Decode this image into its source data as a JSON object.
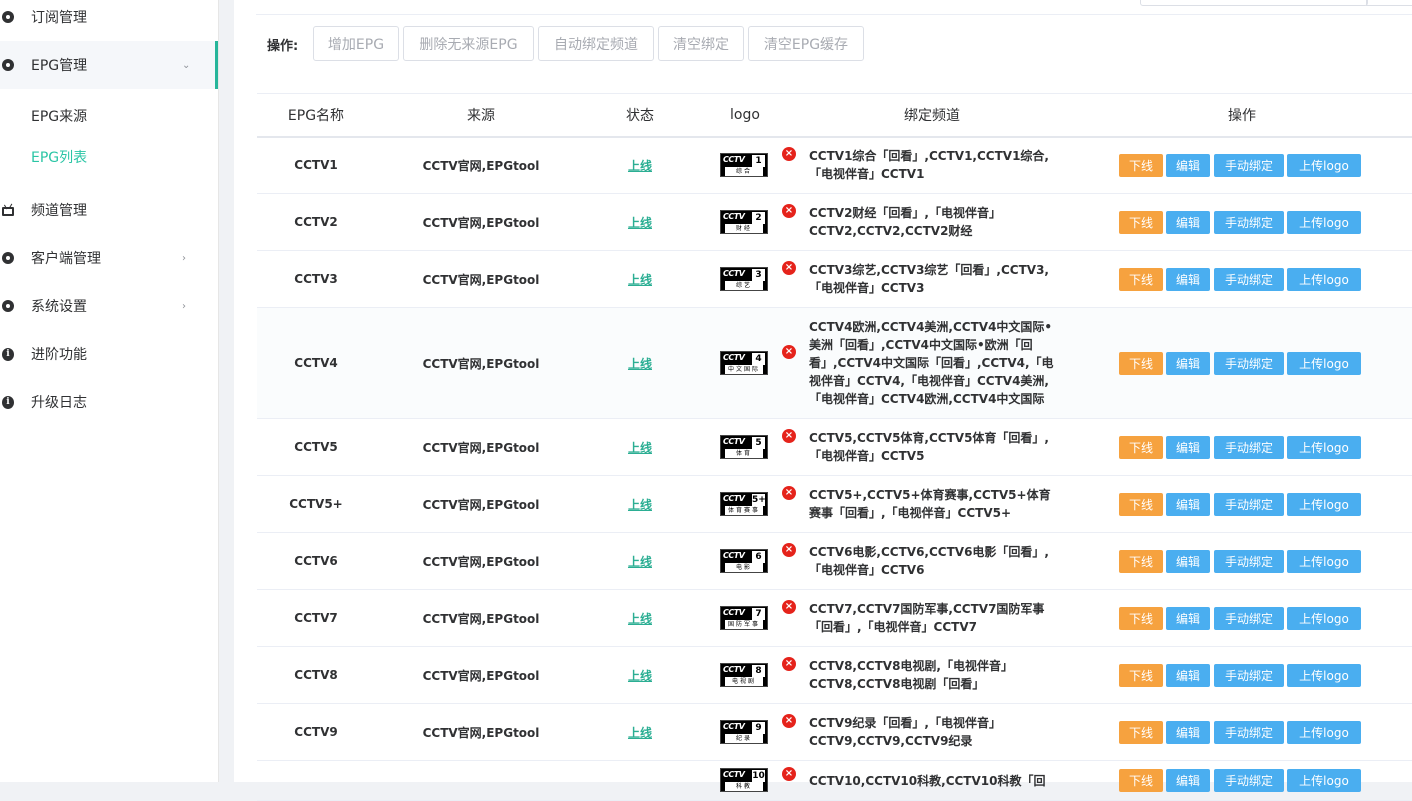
{
  "sidebar": {
    "items": [
      {
        "label": "订阅管理",
        "icon": "subscribe-icon"
      },
      {
        "label": "EPG管理",
        "icon": "gear-icon"
      },
      {
        "label": "EPG来源"
      },
      {
        "label": "EPG列表"
      },
      {
        "label": "频道管理",
        "icon": "tv-icon"
      },
      {
        "label": "客户端管理",
        "icon": "gear-icon"
      },
      {
        "label": "系统设置",
        "icon": "gear-icon"
      },
      {
        "label": "进阶功能",
        "icon": "info-icon"
      },
      {
        "label": "升级日志",
        "icon": "info-icon"
      }
    ]
  },
  "toolbar": {
    "label": "操作:",
    "buttons": [
      "增加EPG",
      "删除无来源EPG",
      "自动绑定频道",
      "清空绑定",
      "清空EPG缓存"
    ]
  },
  "table": {
    "headers": [
      "EPG名称",
      "来源",
      "状态",
      "logo",
      "绑定频道",
      "操作"
    ],
    "actions": [
      "下线",
      "编辑",
      "手动绑定",
      "上传logo"
    ],
    "rows": [
      {
        "name": "CCTV1",
        "source": "CCTV官网,EPGtool",
        "status": "上线",
        "logo_num": "1",
        "logo_sub": "综合",
        "bind": "CCTV1综合「回看」,CCTV1,CCTV1综合,「电视伴音」CCTV1"
      },
      {
        "name": "CCTV2",
        "source": "CCTV官网,EPGtool",
        "status": "上线",
        "logo_num": "2",
        "logo_sub": "财经",
        "bind": "CCTV2财经「回看」,「电视伴音」CCTV2,CCTV2,CCTV2财经"
      },
      {
        "name": "CCTV3",
        "source": "CCTV官网,EPGtool",
        "status": "上线",
        "logo_num": "3",
        "logo_sub": "综艺",
        "bind": "CCTV3综艺,CCTV3综艺「回看」,CCTV3,「电视伴音」CCTV3"
      },
      {
        "name": "CCTV4",
        "source": "CCTV官网,EPGtool",
        "status": "上线",
        "logo_num": "4",
        "logo_sub": "中文国际",
        "bind": "CCTV4欧洲,CCTV4美洲,CCTV4中文国际•美洲「回看」,CCTV4中文国际•欧洲「回看」,CCTV4中文国际「回看」,CCTV4,「电视伴音」CCTV4,「电视伴音」CCTV4美洲,「电视伴音」CCTV4欧洲,CCTV4中文国际"
      },
      {
        "name": "CCTV5",
        "source": "CCTV官网,EPGtool",
        "status": "上线",
        "logo_num": "5",
        "logo_sub": "体育",
        "bind": "CCTV5,CCTV5体育,CCTV5体育「回看」,「电视伴音」CCTV5"
      },
      {
        "name": "CCTV5+",
        "source": "CCTV官网,EPGtool",
        "status": "上线",
        "logo_num": "5+",
        "logo_sub": "体育赛事",
        "bind": "CCTV5+,CCTV5+体育赛事,CCTV5+体育赛事「回看」,「电视伴音」CCTV5+"
      },
      {
        "name": "CCTV6",
        "source": "CCTV官网,EPGtool",
        "status": "上线",
        "logo_num": "6",
        "logo_sub": "电影",
        "bind": "CCTV6电影,CCTV6,CCTV6电影「回看」,「电视伴音」CCTV6"
      },
      {
        "name": "CCTV7",
        "source": "CCTV官网,EPGtool",
        "status": "上线",
        "logo_num": "7",
        "logo_sub": "国防军事",
        "bind": "CCTV7,CCTV7国防军事,CCTV7国防军事「回看」,「电视伴音」CCTV7"
      },
      {
        "name": "CCTV8",
        "source": "CCTV官网,EPGtool",
        "status": "上线",
        "logo_num": "8",
        "logo_sub": "电视剧",
        "bind": "CCTV8,CCTV8电视剧,「电视伴音」CCTV8,CCTV8电视剧「回看」"
      },
      {
        "name": "CCTV9",
        "source": "CCTV官网,EPGtool",
        "status": "上线",
        "logo_num": "9",
        "logo_sub": "纪录",
        "bind": "CCTV9纪录「回看」,「电视伴音」CCTV9,CCTV9,CCTV9纪录"
      },
      {
        "name": "",
        "source": "",
        "status": "",
        "logo_num": "10",
        "logo_sub": "科教",
        "bind": "CCTV10,CCTV10科教,CCTV10科教「回"
      }
    ]
  },
  "colors": {
    "accent": "#2bc5a5",
    "offline_button": "#f6a23f",
    "action_button": "#4aaef0",
    "delete_icon": "#e5231b"
  }
}
